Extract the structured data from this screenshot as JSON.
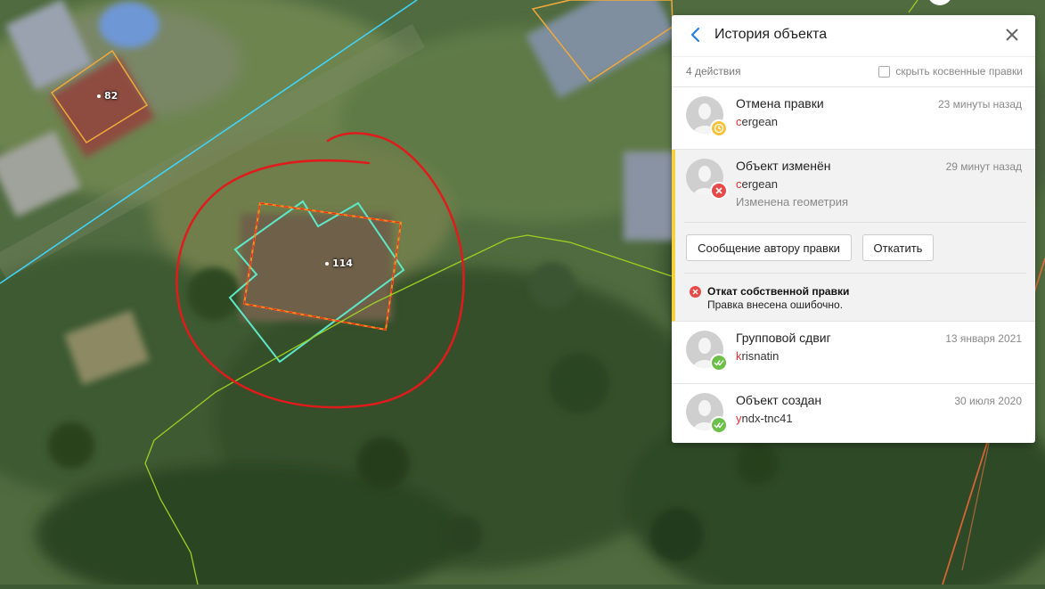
{
  "map": {
    "labels": {
      "parcel_82": "82",
      "parcel_114": "114"
    }
  },
  "panel": {
    "title": "История объекта",
    "count": "4 действия",
    "hide_indirect_label": "скрыть косвенные правки",
    "entries": [
      {
        "title": "Отмена правки",
        "user_first": "c",
        "user_rest": "ergean",
        "time": "23 минуты назад",
        "badge": "clock-icon",
        "badge_color": "#f5c33b"
      },
      {
        "title": "Объект изменён",
        "user_first": "c",
        "user_rest": "ergean",
        "time": "29 минут назад",
        "note": "Изменена геометрия",
        "badge": "x-icon",
        "badge_color": "#e84a4a",
        "buttons": {
          "message": "Сообщение автору правки",
          "revert": "Откатить"
        },
        "revert_info": {
          "title": "Откат собственной правки",
          "desc": "Правка внесена ошибочно."
        }
      },
      {
        "title": "Групповой сдвиг",
        "user_first": "k",
        "user_rest": "risnatin",
        "time": "13 января 2021",
        "badge": "double-check-icon",
        "badge_color": "#6cc04a"
      },
      {
        "title": "Объект создан",
        "user_first": "y",
        "user_rest": "ndx-tnc41",
        "time": "30 июля 2020",
        "badge": "double-check-icon",
        "badge_color": "#6cc04a"
      }
    ]
  },
  "colors": {
    "selected_accent": "#f5d03f",
    "user_first_letter": "#e63333",
    "cadastral_line": "#3fd6ff",
    "parcel_outline": "#f2a93b",
    "building_outline": "#5ee8c8",
    "path_line": "#9ccf24",
    "drawn_circle": "#e01b1b"
  }
}
